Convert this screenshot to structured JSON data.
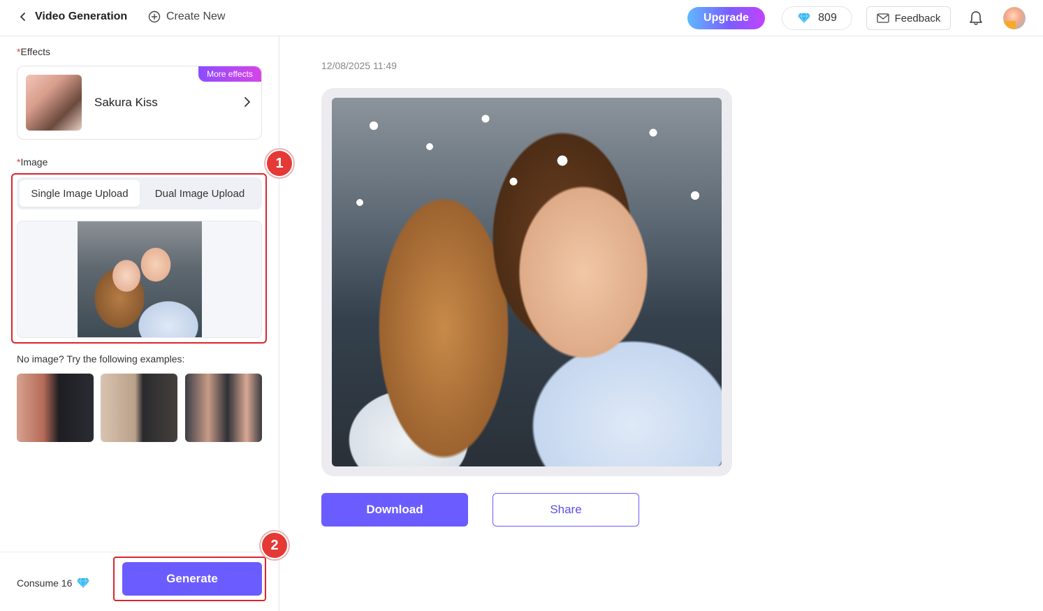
{
  "header": {
    "title": "Video Generation",
    "create_new": "Create New",
    "upgrade": "Upgrade",
    "gems": "809",
    "feedback": "Feedback"
  },
  "left": {
    "effects_label": "Effects",
    "effect_name": "Sakura Kiss",
    "more_effects": "More effects",
    "image_label": "Image",
    "tab_single": "Single Image Upload",
    "tab_dual": "Dual Image Upload",
    "badge_1": "1",
    "badge_2": "2",
    "examples_label": "No image? Try the following examples:",
    "consume": "Consume 16",
    "generate": "Generate"
  },
  "main": {
    "timestamp": "12/08/2025 11:49",
    "download": "Download",
    "share": "Share"
  },
  "colors": {
    "accent": "#6b5cff",
    "highlight": "#d9262b",
    "badge": "#e53935"
  }
}
